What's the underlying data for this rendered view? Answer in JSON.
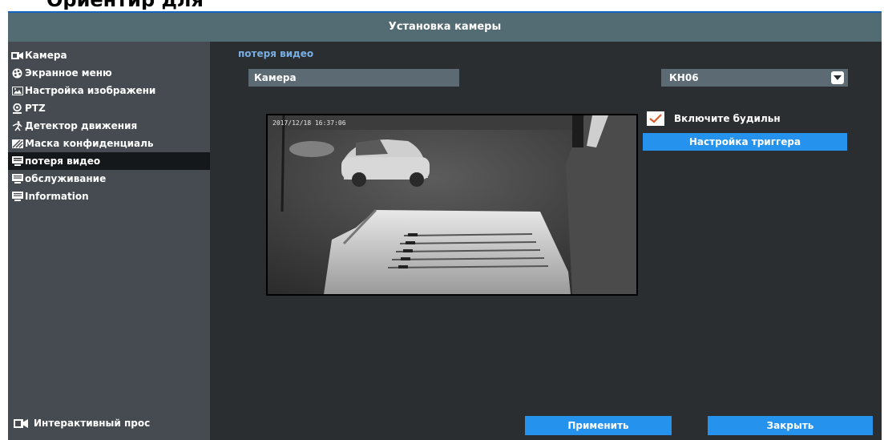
{
  "page_heading_fragment": "Ориентир для",
  "window": {
    "title": "Установка камеры"
  },
  "sidebar": {
    "items": [
      {
        "label": "Камера",
        "icon": "camera-icon",
        "active": false
      },
      {
        "label": "Экранное меню",
        "icon": "palette-icon",
        "active": false
      },
      {
        "label": "Настройка изображени",
        "icon": "image-icon",
        "active": false
      },
      {
        "label": "PTZ",
        "icon": "ptz-icon",
        "active": false
      },
      {
        "label": "Детектор движения",
        "icon": "motion-icon",
        "active": false
      },
      {
        "label": "Маска конфиденциаль",
        "icon": "mask-icon",
        "active": false
      },
      {
        "label": "потеря видео",
        "icon": "monitor-icon",
        "active": true
      },
      {
        "label": "обслуживание",
        "icon": "monitor-icon",
        "active": false
      },
      {
        "label": "Information",
        "icon": "monitor-icon",
        "active": false
      }
    ],
    "footer": {
      "label": "Интерактивный прос",
      "icon": "camera-icon"
    }
  },
  "main": {
    "section_title": "потеря видео",
    "camera_field": {
      "label": "Камера"
    },
    "channel_select": {
      "value": "КН06"
    },
    "preview": {
      "timestamp": "2017/12/18 16:37:06"
    },
    "alarm_checkbox": {
      "label": "Включите будильн",
      "checked": true
    },
    "trigger_button": {
      "label": "Настройка триггера"
    },
    "apply_button": {
      "label": "Применить"
    },
    "close_button": {
      "label": "Закрыть"
    }
  },
  "colors": {
    "accent": "#2592ee",
    "section_title": "#79aee3",
    "titlebar": "#536b72",
    "sidebar": "#454b51",
    "panel": "#2a2e30",
    "active_item": "#15181a",
    "checkmark": "#e05a2a"
  }
}
